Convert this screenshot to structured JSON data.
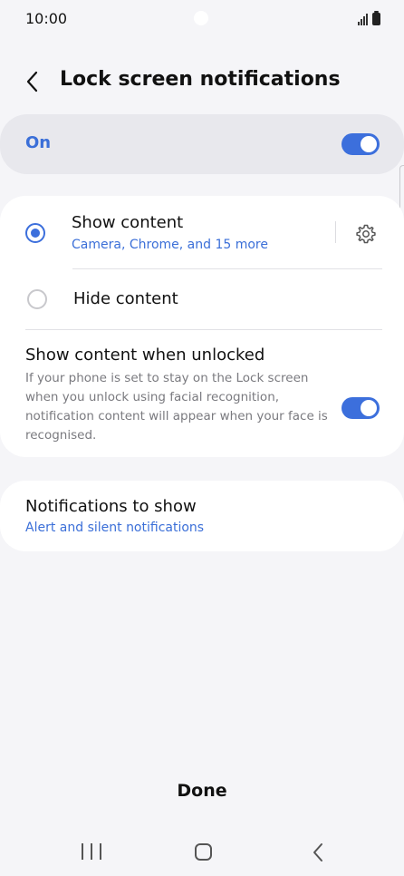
{
  "status_bar": {
    "time": "10:00"
  },
  "header": {
    "title": "Lock screen notifications",
    "back_icon": "chevron-left-icon"
  },
  "master_toggle": {
    "label": "On",
    "state": "on"
  },
  "options": {
    "show_content": {
      "title": "Show content",
      "subtitle": "Camera, Chrome, and 15 more",
      "selected": true,
      "settings_icon": "gear-icon"
    },
    "hide_content": {
      "title": "Hide content",
      "selected": false
    },
    "show_when_unlocked": {
      "title": "Show content when unlocked",
      "description": "If your phone is set to stay on the Lock screen when you unlock using facial recognition, notification content will appear when your face is recognised.",
      "state": "on"
    }
  },
  "notifications_to_show": {
    "title": "Notifications to show",
    "value": "Alert and silent notifications"
  },
  "footer": {
    "done_label": "Done"
  },
  "nav_bar": {
    "recent_icon": "recent-apps-icon",
    "home_icon": "home-icon",
    "back_icon": "back-icon"
  },
  "colors": {
    "accent": "#3c6fdc",
    "background": "#f5f5f8",
    "card": "#ffffff"
  }
}
